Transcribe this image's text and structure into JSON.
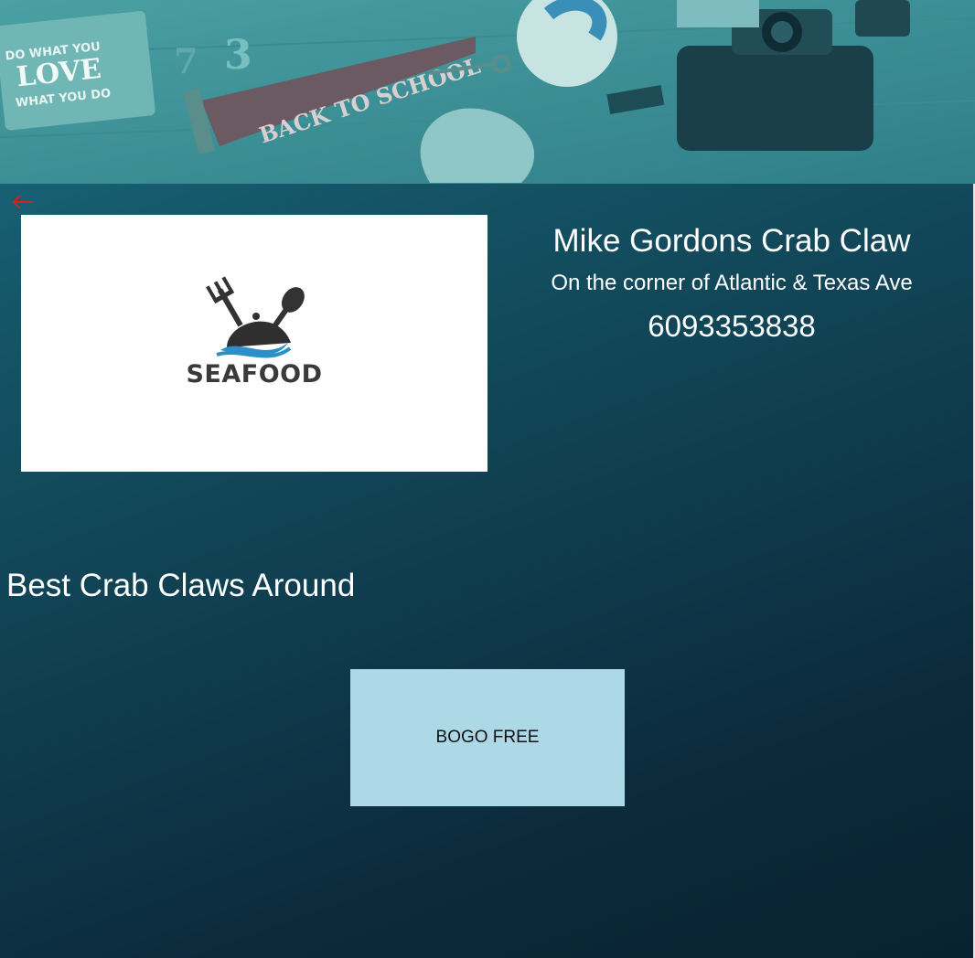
{
  "hero": {
    "image_icon": "decorative-desk-photo",
    "pennant_text": "BACK TO SCHOOL",
    "book_text": [
      "DO WHAT YOU",
      "LOVE",
      "WHAT YOU DO"
    ]
  },
  "nav": {
    "back_icon": "arrow-left-icon",
    "back_symbol": "←",
    "accent_color": "#d42020"
  },
  "restaurant": {
    "logo_text": "SEAFOOD",
    "name": "Mike Gordons Crab Claw",
    "address": "On the corner of Atlantic & Texas Ave",
    "phone": "6093353838",
    "tagline": "Best Crab Claws Around"
  },
  "deal": {
    "label": "BOGO FREE",
    "color": "#add8e6"
  }
}
